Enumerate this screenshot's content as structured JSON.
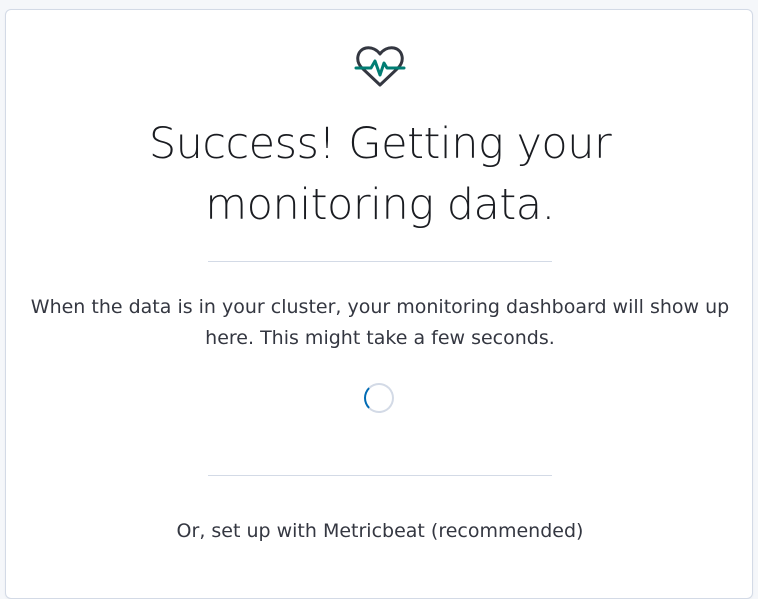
{
  "panel": {
    "icon": "heartbeat-icon",
    "title": "Success! Getting your monitoring data.",
    "description": "When the data is in your cluster, your monitoring dashboard will show up here. This might take a few seconds.",
    "loading_indicator": "loading-spinner",
    "alternative_action": "Or, set up with Metricbeat (recommended)"
  },
  "colors": {
    "icon_outline": "#343741",
    "icon_pulse": "#017d73",
    "spinner_accent": "#006bb4",
    "divider": "#d3dae6"
  }
}
